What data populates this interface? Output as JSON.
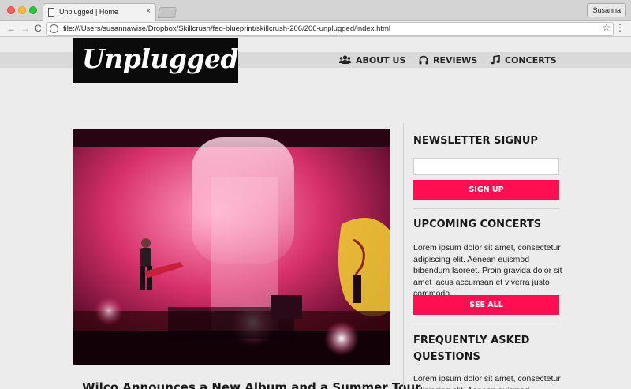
{
  "browser": {
    "tab_title": "Unplugged | Home",
    "tab_close": "×",
    "user": "Susanna",
    "back": "←",
    "forward": "→",
    "reload": "C",
    "info": "i",
    "url": "file:///Users/susannawise/Dropbox/Skillcrush/fed-blueprint/skillcrush-206/206-unplugged/index.html",
    "bookmark": "☆",
    "menu": "⋮"
  },
  "site": {
    "logo": "Unplugged",
    "nav": [
      {
        "label": "ABOUT US",
        "icon": "users-icon"
      },
      {
        "label": "REVIEWS",
        "icon": "headphones-icon"
      },
      {
        "label": "CONCERTS",
        "icon": "music-note-icon"
      }
    ]
  },
  "main": {
    "hero_alt": "Concert stage photo",
    "article_title": "Wilco Announces a New Album and a Summer Tour"
  },
  "sidebar": {
    "newsletter": {
      "heading": "NEWSLETTER SIGNUP",
      "input_value": "",
      "button": "SIGN UP"
    },
    "concerts": {
      "heading": "UPCOMING CONCERTS",
      "body": "Lorem ipsum dolor sit amet, consectetur adipiscing elit. Aenean euismod bibendum laoreet. Proin gravida dolor sit amet lacus accumsan et viverra justo commodo.",
      "button": "SEE ALL"
    },
    "faq": {
      "heading": "FREQUENTLY ASKED QUESTIONS",
      "body": "Lorem ipsum dolor sit amet, consectetur adipiscing elit. Aenean euismod bibendum laoreet."
    }
  },
  "colors": {
    "accent": "#ff0f52",
    "logo_bg": "#0b0b0b",
    "page_bg": "#ececec",
    "nav_band": "#d9d9d9"
  }
}
